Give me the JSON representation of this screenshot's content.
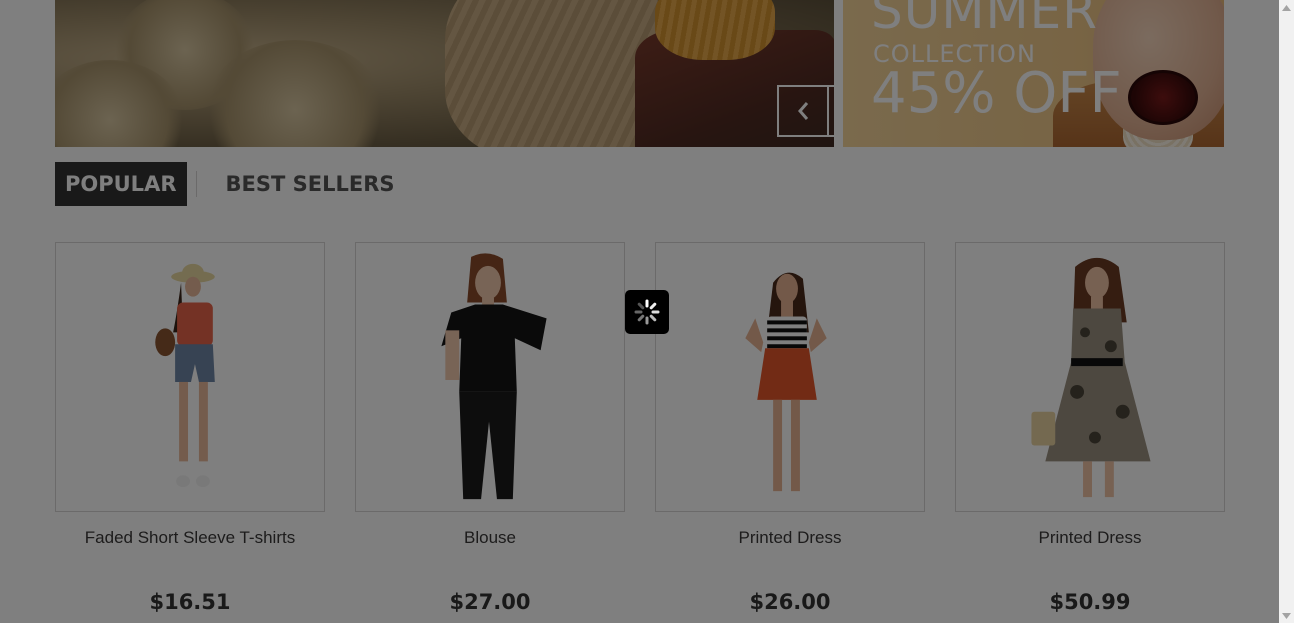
{
  "banner": {
    "promo_title": "SUMMER",
    "promo_subtitle": "COLLECTION",
    "promo_discount": "45% OFF",
    "prev_icon": "chevron-left-icon",
    "next_icon": "chevron-right-icon"
  },
  "tabs": [
    {
      "label": "POPULAR",
      "active": true
    },
    {
      "label": "BEST SELLERS",
      "active": false
    }
  ],
  "products": [
    {
      "name": "Faded Short Sleeve T-shirts",
      "price": "$16.51"
    },
    {
      "name": "Blouse",
      "price": "$27.00"
    },
    {
      "name": "Printed Dress",
      "price": "$26.00"
    },
    {
      "name": "Printed Dress",
      "price": "$50.99"
    }
  ],
  "overlay": {
    "spinner_icon": "loading-spinner-icon",
    "color": "#000000"
  },
  "colors": {
    "tab_active_bg": "#333333",
    "border": "#d6d4d4"
  }
}
